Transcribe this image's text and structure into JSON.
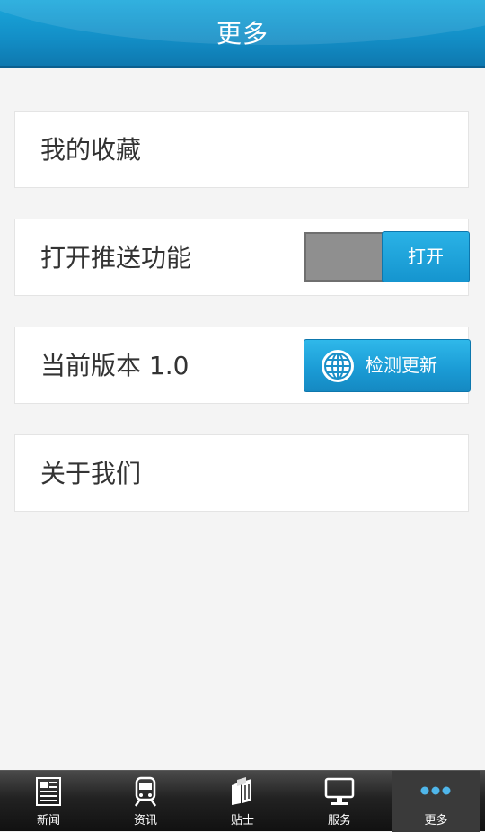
{
  "header": {
    "title": "更多"
  },
  "menu": {
    "favorites": {
      "label": "我的收藏"
    },
    "push": {
      "label": "打开推送功能",
      "toggle_label": "打开",
      "enabled": false
    },
    "version": {
      "label": "当前版本 1.0",
      "update_button_label": "检测更新"
    },
    "about": {
      "label": "关于我们"
    }
  },
  "tabbar": {
    "items": [
      {
        "label": "新闻",
        "icon": "newspaper-icon"
      },
      {
        "label": "资讯",
        "icon": "train-icon"
      },
      {
        "label": "贴士",
        "icon": "books-icon"
      },
      {
        "label": "服务",
        "icon": "monitor-icon"
      },
      {
        "label": "更多",
        "icon": "more-dots-icon"
      }
    ],
    "active_index": 4
  },
  "colors": {
    "header_blue": "#138fc7",
    "accent_blue": "#1a9ad4",
    "toggle_off_gray": "#8f8f8f",
    "background": "#f4f4f4",
    "tabbar_dark": "#222222"
  }
}
